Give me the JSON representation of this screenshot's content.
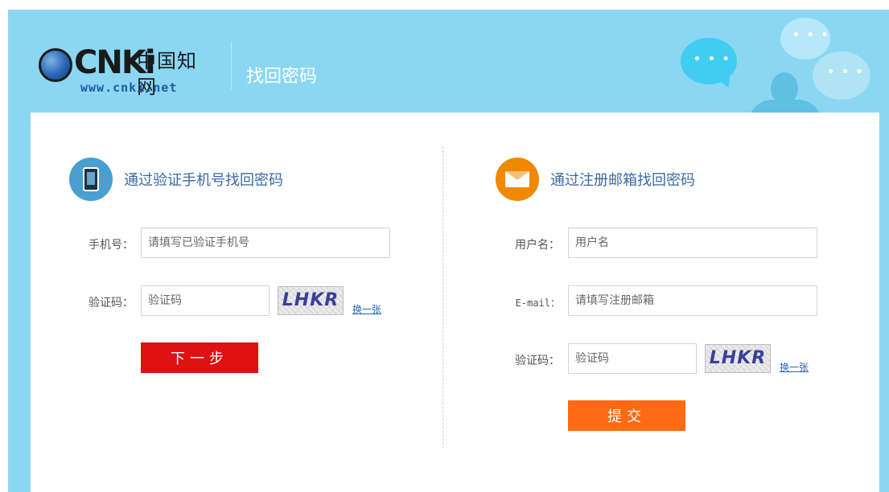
{
  "header": {
    "logo_cnki": "CNKi",
    "logo_chinese": "中国知网",
    "logo_url": "www.cnki.net",
    "page_title": "找回密码"
  },
  "colors": {
    "frame_bg": "#8bd7f3",
    "next_button": "#e01111",
    "submit_button": "#ff6a14",
    "phone_icon": "#4a9fd0",
    "mail_icon": "#f08800",
    "section_title": "#3b6aa3"
  },
  "phone_section": {
    "icon": "phone-icon",
    "title": "通过验证手机号找回密码",
    "phone_label": "手机号：",
    "phone_placeholder": "请填写已验证手机号",
    "captcha_label": "验证码：",
    "captcha_placeholder": "验证码",
    "captcha_text": "LHKR",
    "refresh_label": "换一张",
    "next_button": "下一步"
  },
  "email_section": {
    "icon": "mail-icon",
    "title": "通过注册邮箱找回密码",
    "username_label": "用户名：",
    "username_placeholder": "用户名",
    "email_label": "E-mail：",
    "email_placeholder": "请填写注册邮箱",
    "captcha_label": "验证码：",
    "captcha_placeholder": "验证码",
    "captcha_text": "LHKR",
    "refresh_label": "换一张",
    "submit_button": "提交"
  }
}
